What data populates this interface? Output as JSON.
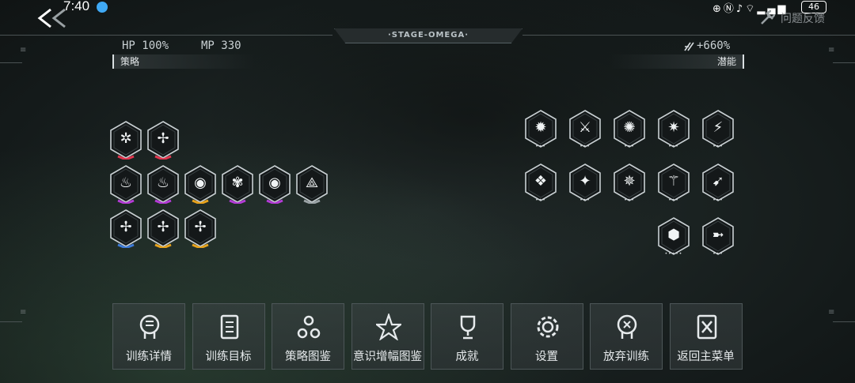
{
  "status_bar": {
    "time": "7:40",
    "battery": "46",
    "feedback_label": "问题反馈"
  },
  "hud": {
    "stage": "·STAGE-OMEGA·",
    "hp": "HP 100%",
    "mp": "MP 330",
    "boost": "+660%",
    "strategy_label": "策略",
    "potential_label": "潜能"
  },
  "strategy_rows": [
    [
      {
        "icon": "crosshair-burst-icon",
        "glyph": "✲",
        "accent": "#e2364f"
      },
      {
        "icon": "crosshair-plus-icon",
        "glyph": "✢",
        "accent": "#e2364f"
      }
    ],
    [
      {
        "icon": "flame-claw-icon",
        "glyph": "♨",
        "accent": "#b43bd6"
      },
      {
        "icon": "flame-rise-icon",
        "glyph": "♨",
        "accent": "#b43bd6"
      },
      {
        "icon": "eye-pod-icon",
        "glyph": "◉",
        "accent": "#e7a21c"
      },
      {
        "icon": "flower-cross-icon",
        "glyph": "✾",
        "accent": "#b43bd6"
      },
      {
        "icon": "eye-pod-alt-icon",
        "glyph": "◉",
        "accent": "#b43bd6"
      },
      {
        "icon": "tri-branch-icon",
        "glyph": "⟁",
        "accent": "#9aa2a5"
      }
    ],
    [
      {
        "icon": "crosshair-dot-icon",
        "glyph": "✢",
        "accent": "#3d7ad8"
      },
      {
        "icon": "crosshair-swap-icon",
        "glyph": "✢",
        "accent": "#e7a21c"
      },
      {
        "icon": "crosshair-down-icon",
        "glyph": "✢",
        "accent": "#e7a21c"
      }
    ]
  ],
  "potential_rows": [
    [
      {
        "icon": "shatter-strike-icon",
        "glyph": "✹",
        "dots": "•••"
      },
      {
        "icon": "slash-leap-icon",
        "glyph": "⚔",
        "dots": "•••"
      },
      {
        "icon": "burst-fist-icon",
        "glyph": "✺",
        "dots": "•••"
      },
      {
        "icon": "star-spark-icon",
        "glyph": "✷",
        "dots": "•••"
      },
      {
        "icon": "high-kick-icon",
        "glyph": "⚡",
        "dots": "•••"
      }
    ],
    [
      {
        "icon": "ground-stomp-icon",
        "glyph": "❖",
        "dots": "•••"
      },
      {
        "icon": "blade-cut-icon",
        "glyph": "✦",
        "dots": "•••"
      },
      {
        "icon": "shield-ring-icon",
        "glyph": "✵",
        "dots": "•••"
      },
      {
        "icon": "lance-stance-icon",
        "glyph": "⚚",
        "dots": "•••"
      },
      {
        "icon": "dash-slash-icon",
        "glyph": "➹",
        "dots": "•••"
      }
    ],
    [
      {
        "icon": "hex-cluster-icon",
        "glyph": "⬢",
        "dots": "•••••"
      },
      {
        "icon": "sprint-icon",
        "glyph": "➼",
        "dots": "•••"
      }
    ]
  ],
  "menu": [
    {
      "name": "training-details",
      "label": "训练详情",
      "icon": "head-bubble-icon"
    },
    {
      "name": "training-goals",
      "label": "训练目标",
      "icon": "list-doc-icon"
    },
    {
      "name": "strategy-codex",
      "label": "策略图鉴",
      "icon": "tri-node-icon"
    },
    {
      "name": "consciousness-codex",
      "label": "意识增幅图鉴",
      "icon": "star-burst-icon"
    },
    {
      "name": "achievements",
      "label": "成就",
      "icon": "trophy-icon"
    },
    {
      "name": "settings",
      "label": "设置",
      "icon": "gear-icon"
    },
    {
      "name": "abandon-training",
      "label": "放弃训练",
      "icon": "head-x-icon"
    },
    {
      "name": "main-menu",
      "label": "返回主菜单",
      "icon": "exit-door-icon"
    }
  ]
}
